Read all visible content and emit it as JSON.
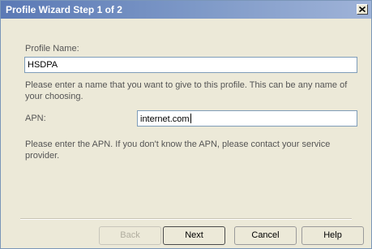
{
  "window": {
    "title": "Profile Wizard Step 1 of 2",
    "close_glyph": "close-icon"
  },
  "form": {
    "profile_name_label": "Profile Name:",
    "profile_name_value": "HSDPA",
    "profile_name_help": "Please enter a name that you want to give to this profile. This can be any name of your choosing.",
    "apn_label": "APN:",
    "apn_value": "internet.com",
    "apn_help": "Please enter the APN.  If you don't know the APN, please contact your service provider."
  },
  "buttons": {
    "back": "Back",
    "next": "Next",
    "cancel": "Cancel",
    "help": "Help"
  },
  "colors": {
    "titlebar_start": "#5b79b5",
    "titlebar_end": "#9fb3d8",
    "dialog_bg": "#ece9d8"
  }
}
